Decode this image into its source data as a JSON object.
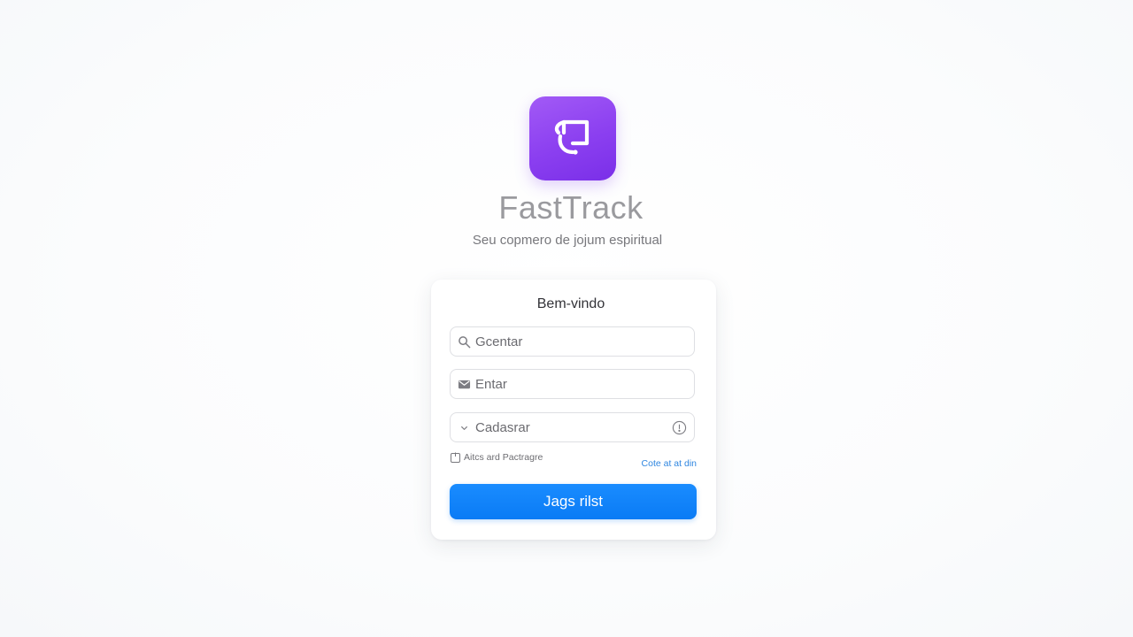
{
  "app": {
    "name": "FastTrack",
    "tagline": "Seu copmero de jojum espiritual",
    "logo_icon": "speech-bubble-icon",
    "brand_color": "#8b3ff0"
  },
  "card": {
    "title": "Bem-vindo",
    "fields": [
      {
        "icon": "search-icon",
        "value": "Gcentar"
      },
      {
        "icon": "mail-icon",
        "value": "Entar"
      },
      {
        "icon": "chevron-down-icon",
        "value": "Cadasrar",
        "trailing_icon": "info-icon"
      }
    ],
    "remember_label": "Aitcs ard Pactragre",
    "forgot_link": "Cote at at din",
    "submit_label": "Jags rilst",
    "accent_color": "#0a7bf5"
  }
}
